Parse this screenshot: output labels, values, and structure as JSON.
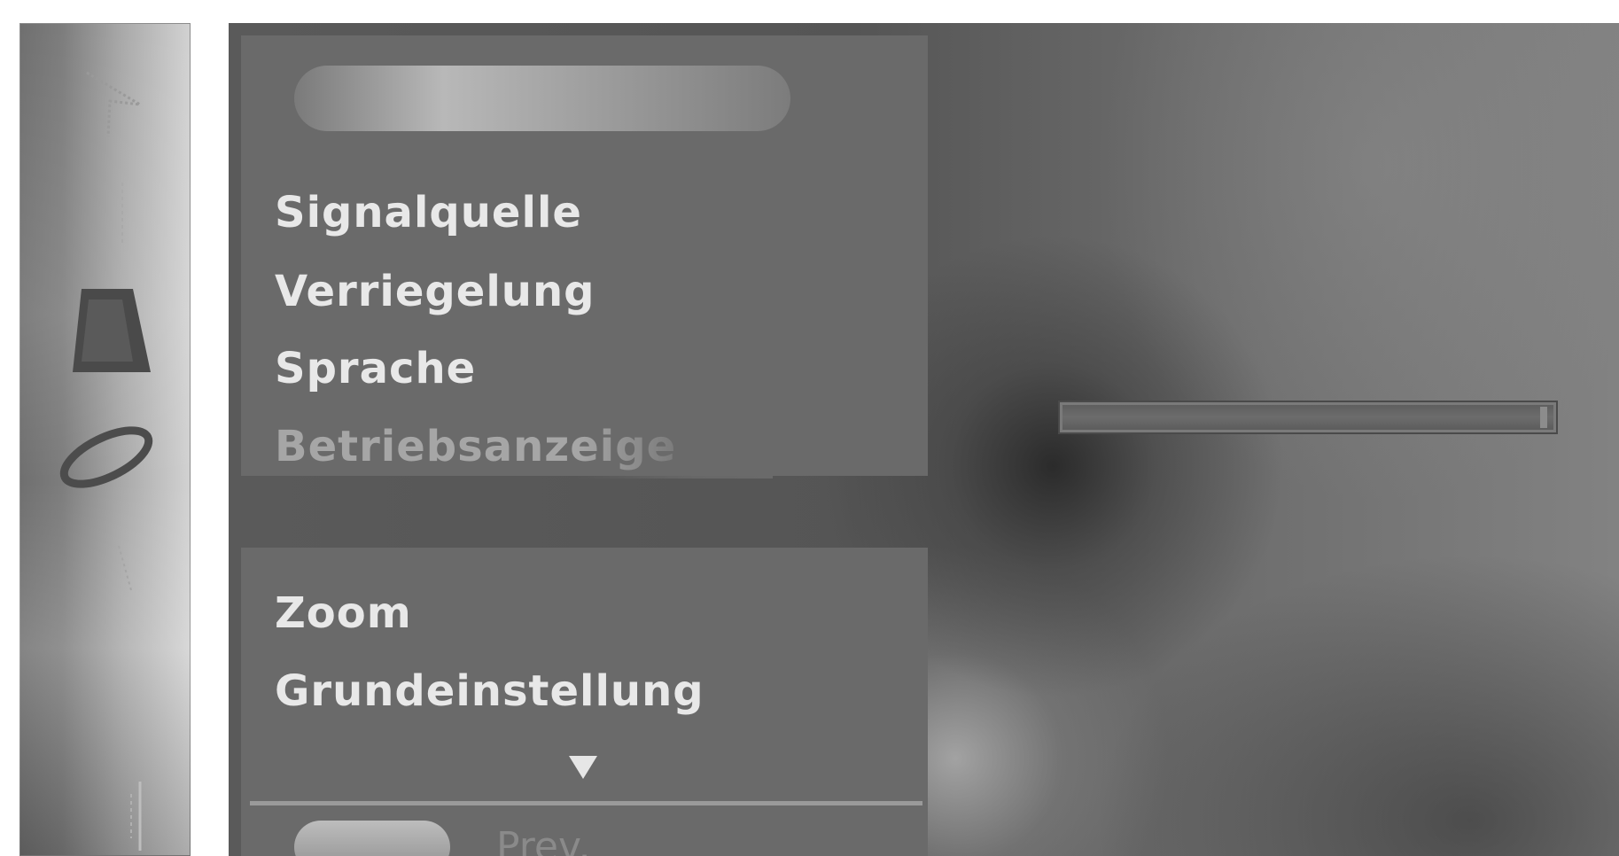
{
  "sidebar": {
    "icons": [
      {
        "name": "picture-icon"
      },
      {
        "name": "sound-icon"
      },
      {
        "name": "setup-icon"
      },
      {
        "name": "timer-icon"
      },
      {
        "name": "channel-icon"
      },
      {
        "name": "input-icon"
      }
    ]
  },
  "menu": {
    "items": [
      {
        "label": "Signalquelle"
      },
      {
        "label": "Verriegelung"
      },
      {
        "label": "Sprache"
      },
      {
        "label": "Betriebsanzeige"
      }
    ],
    "lower_items": [
      {
        "label": "Zoom"
      },
      {
        "label": "Grundeinstellung"
      }
    ],
    "prev_label": "Prev."
  }
}
